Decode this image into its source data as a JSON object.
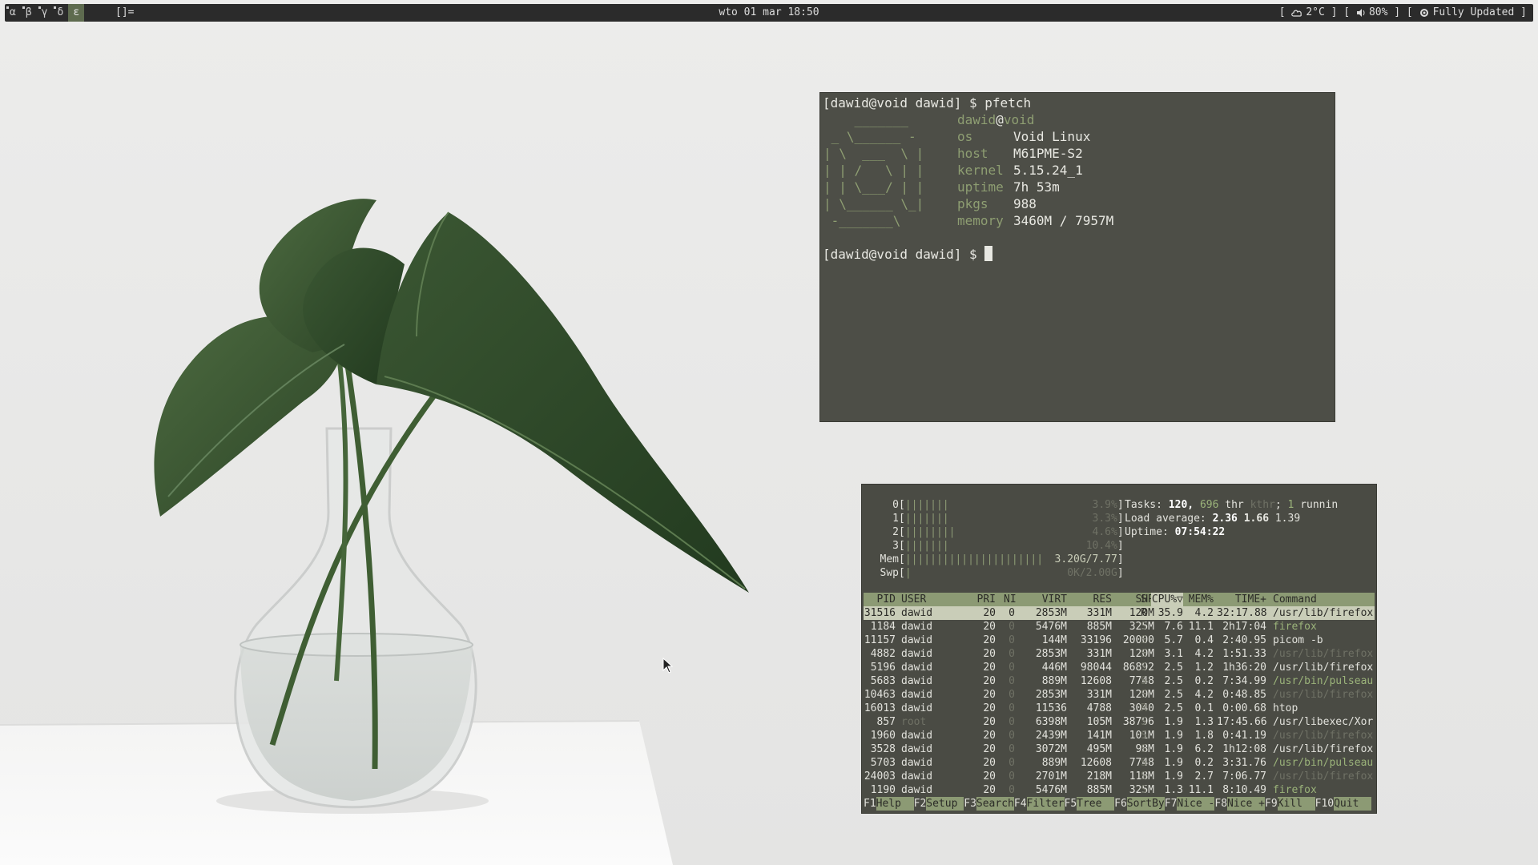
{
  "topbar": {
    "tags": [
      "α",
      "β",
      "γ",
      "δ",
      "ε"
    ],
    "active_tag": 4,
    "layout_symbol": "[]=",
    "clock": "wto 01 mar 18:50",
    "status": {
      "weather": "2°C",
      "volume": "80%",
      "updates": "Fully Updated"
    }
  },
  "terminal": {
    "prompt1": "[dawid@void dawid] $ pfetch",
    "logo": [
      "    _______",
      " _ \\______ -",
      "| \\  ___  \\ |",
      "| | /   \\ | |",
      "| | \\___/ | |",
      "| \\______ \\_|",
      " -_______\\"
    ],
    "user": "dawid",
    "at": "@",
    "host": "void",
    "info": [
      {
        "label": "os",
        "value": "Void Linux"
      },
      {
        "label": "host",
        "value": "M61PME-S2"
      },
      {
        "label": "kernel",
        "value": "5.15.24_1"
      },
      {
        "label": "uptime",
        "value": "7h 53m"
      },
      {
        "label": "pkgs",
        "value": "988"
      },
      {
        "label": "memory",
        "value": "3460M / 7957M"
      }
    ],
    "prompt2": "[dawid@void dawid] $ "
  },
  "htop": {
    "cpus": [
      {
        "id": "0",
        "bars": "|||||||",
        "pct": "3.9%"
      },
      {
        "id": "1",
        "bars": "|||||||",
        "pct": "3.3%"
      },
      {
        "id": "2",
        "bars": "||||||||",
        "pct": "4.6%"
      },
      {
        "id": "3",
        "bars": "|||||||",
        "pct": "10.4%"
      }
    ],
    "mem": {
      "bars": "||||||||||||||||||||||",
      "value": "3.20G/7.77"
    },
    "swp": {
      "bars": "|",
      "value": "0K/2.00G"
    },
    "tasks_label": "Tasks:",
    "tasks": "120,",
    "threads": "696",
    "thr_label": "thr",
    "kthr": "kthr",
    "running": "1",
    "running_label": "runnin",
    "load_label": "Load average:",
    "load": [
      "2.36",
      "1.66",
      "1.39"
    ],
    "uptime_label": "Uptime:",
    "uptime": "07:54:22",
    "columns": [
      "PID",
      "USER",
      "PRI",
      "NI",
      "VIRT",
      "RES",
      "SHR",
      "S",
      "CPU%▽",
      "MEM%",
      "TIME+",
      "Command"
    ],
    "rows": [
      {
        "pid": "31516",
        "user": "dawid",
        "pri": "20",
        "ni": "0",
        "virt": "2853M",
        "res": "331M",
        "shr": "120M",
        "s": "R",
        "cpu": "35.9",
        "mem": "4.2",
        "time": "32:17.88",
        "cmd": "/usr/lib/firefox",
        "sel": true
      },
      {
        "pid": "1184",
        "user": "dawid",
        "pri": "20",
        "ni": "0",
        "virt": "5476M",
        "res": "885M",
        "shr": "325M",
        "s": "S",
        "cpu": "7.6",
        "mem": "11.1",
        "time": "2h17:04",
        "cmd": "firefox"
      },
      {
        "pid": "11157",
        "user": "dawid",
        "pri": "20",
        "ni": "0",
        "virt": "144M",
        "res": "33196",
        "shr": "20000",
        "s": "S",
        "cpu": "5.7",
        "mem": "0.4",
        "time": "2:40.95",
        "cmd": "picom -b"
      },
      {
        "pid": "4882",
        "user": "dawid",
        "pri": "20",
        "ni": "0",
        "virt": "2853M",
        "res": "331M",
        "shr": "120M",
        "s": "S",
        "cpu": "3.1",
        "mem": "4.2",
        "time": "1:51.33",
        "cmd": "/usr/lib/firefox"
      },
      {
        "pid": "5196",
        "user": "dawid",
        "pri": "20",
        "ni": "0",
        "virt": "446M",
        "res": "98044",
        "shr": "86892",
        "s": "S",
        "cpu": "2.5",
        "mem": "1.2",
        "time": "1h36:20",
        "cmd": "/usr/lib/firefox"
      },
      {
        "pid": "5683",
        "user": "dawid",
        "pri": "20",
        "ni": "0",
        "virt": "889M",
        "res": "12608",
        "shr": "7748",
        "s": "S",
        "cpu": "2.5",
        "mem": "0.2",
        "time": "7:34.99",
        "cmd": "/usr/bin/pulseau"
      },
      {
        "pid": "10463",
        "user": "dawid",
        "pri": "20",
        "ni": "0",
        "virt": "2853M",
        "res": "331M",
        "shr": "120M",
        "s": "S",
        "cpu": "2.5",
        "mem": "4.2",
        "time": "0:48.85",
        "cmd": "/usr/lib/firefox"
      },
      {
        "pid": "16013",
        "user": "dawid",
        "pri": "20",
        "ni": "0",
        "virt": "11536",
        "res": "4788",
        "shr": "3040",
        "s": "R",
        "cpu": "2.5",
        "mem": "0.1",
        "time": "0:00.68",
        "cmd": "htop"
      },
      {
        "pid": "857",
        "user": "root",
        "pri": "20",
        "ni": "0",
        "virt": "6398M",
        "res": "105M",
        "shr": "38796",
        "s": "S",
        "cpu": "1.9",
        "mem": "1.3",
        "time": "17:45.66",
        "cmd": "/usr/libexec/Xor"
      },
      {
        "pid": "1960",
        "user": "dawid",
        "pri": "20",
        "ni": "0",
        "virt": "2439M",
        "res": "141M",
        "shr": "101M",
        "s": "S",
        "cpu": "1.9",
        "mem": "1.8",
        "time": "0:41.19",
        "cmd": "/usr/lib/firefox"
      },
      {
        "pid": "3528",
        "user": "dawid",
        "pri": "20",
        "ni": "0",
        "virt": "3072M",
        "res": "495M",
        "shr": "98M",
        "s": "S",
        "cpu": "1.9",
        "mem": "6.2",
        "time": "1h12:08",
        "cmd": "/usr/lib/firefox"
      },
      {
        "pid": "5703",
        "user": "dawid",
        "pri": "20",
        "ni": "0",
        "virt": "889M",
        "res": "12608",
        "shr": "7748",
        "s": "S",
        "cpu": "1.9",
        "mem": "0.2",
        "time": "3:31.76",
        "cmd": "/usr/bin/pulseau"
      },
      {
        "pid": "24003",
        "user": "dawid",
        "pri": "20",
        "ni": "0",
        "virt": "2701M",
        "res": "218M",
        "shr": "118M",
        "s": "S",
        "cpu": "1.9",
        "mem": "2.7",
        "time": "7:06.77",
        "cmd": "/usr/lib/firefox"
      },
      {
        "pid": "1190",
        "user": "dawid",
        "pri": "20",
        "ni": "0",
        "virt": "5476M",
        "res": "885M",
        "shr": "325M",
        "s": "S",
        "cpu": "1.3",
        "mem": "11.1",
        "time": "8:10.49",
        "cmd": "firefox"
      }
    ],
    "fkeys": [
      {
        "key": "F1",
        "label": "Help  "
      },
      {
        "key": "F2",
        "label": "Setup "
      },
      {
        "key": "F3",
        "label": "Search"
      },
      {
        "key": "F4",
        "label": "Filter"
      },
      {
        "key": "F5",
        "label": "Tree  "
      },
      {
        "key": "F6",
        "label": "SortBy"
      },
      {
        "key": "F7",
        "label": "Nice -"
      },
      {
        "key": "F8",
        "label": "Nice +"
      },
      {
        "key": "F9",
        "label": "Kill  "
      },
      {
        "key": "F10",
        "label": "Quit  "
      }
    ]
  },
  "colors": {
    "bar_bg": "#2b2b2b",
    "accent": "#8c9a74",
    "terminal_bg": "#4d4e47"
  }
}
